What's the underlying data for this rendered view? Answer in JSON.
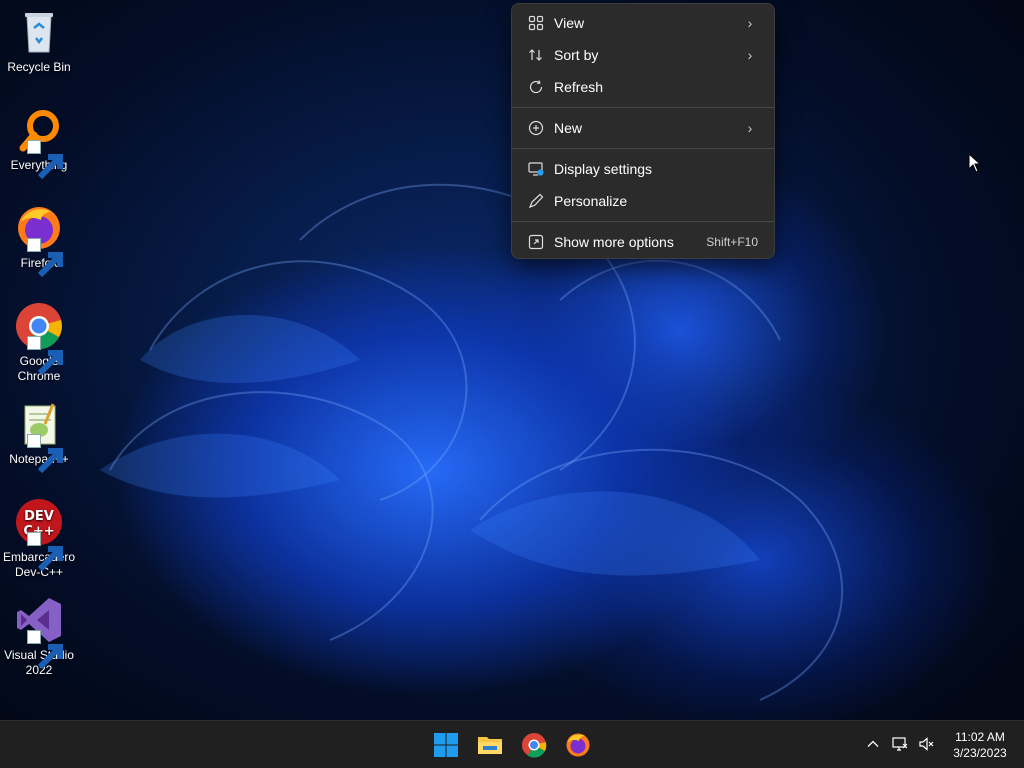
{
  "desktop_icons": [
    {
      "label": "Recycle Bin",
      "icon": "recycle-bin-icon",
      "shortcut": false
    },
    {
      "label": "Everything",
      "icon": "everything-search-icon",
      "shortcut": true
    },
    {
      "label": "Firefox",
      "icon": "firefox-icon",
      "shortcut": true
    },
    {
      "label": "Google Chrome",
      "icon": "chrome-icon",
      "shortcut": true
    },
    {
      "label": "Notepad++",
      "icon": "notepadpp-icon",
      "shortcut": true
    },
    {
      "label": "Embarcadero Dev-C++",
      "icon": "devcpp-icon",
      "shortcut": true
    },
    {
      "label": "Visual Studio 2022",
      "icon": "visual-studio-icon",
      "shortcut": true
    }
  ],
  "context_menu": {
    "items": [
      {
        "label": "View",
        "icon": "grid-view-icon",
        "submenu": true
      },
      {
        "label": "Sort by",
        "icon": "sort-icon",
        "submenu": true
      },
      {
        "label": "Refresh",
        "icon": "refresh-icon",
        "submenu": false
      },
      {
        "label": "New",
        "icon": "plus-circle-icon",
        "submenu": true
      },
      {
        "label": "Display settings",
        "icon": "display-settings-icon",
        "submenu": false
      },
      {
        "label": "Personalize",
        "icon": "pen-icon",
        "submenu": false
      },
      {
        "label": "Show more options",
        "icon": "expand-icon",
        "submenu": false,
        "accelerator": "Shift+F10"
      }
    ],
    "chevron": "›"
  },
  "taskbar": {
    "pinned": [
      {
        "name": "Start",
        "icon": "windows-start-icon"
      },
      {
        "name": "File Explorer",
        "icon": "file-explorer-icon"
      },
      {
        "name": "Google Chrome",
        "icon": "chrome-icon"
      },
      {
        "name": "Firefox",
        "icon": "firefox-icon"
      }
    ],
    "tray": {
      "overflow_icon": "chevron-up-icon",
      "network_icon": "network-icon",
      "volume_icon": "volume-muted-icon"
    },
    "clock": {
      "time": "11:02 AM",
      "date": "3/23/2023"
    }
  },
  "colors": {
    "menu_bg": "#2b2b2b",
    "taskbar_bg": "#202020",
    "windows_blue": "#1f9bf0"
  }
}
